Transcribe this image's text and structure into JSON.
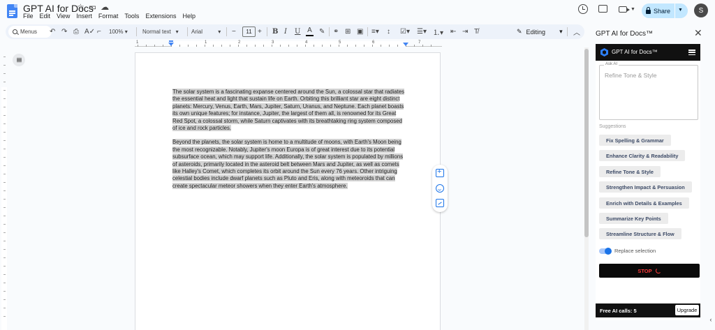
{
  "app": {
    "doc_title": "GPT AI for Docs",
    "menu": [
      "File",
      "Edit",
      "View",
      "Insert",
      "Format",
      "Tools",
      "Extensions",
      "Help"
    ],
    "share_label": "Share",
    "avatar_initial": "S"
  },
  "toolbar": {
    "menus_label": "Menus",
    "zoom": "100%",
    "style": "Normal text",
    "font": "Arial",
    "font_size": "11",
    "mode": "Editing"
  },
  "ruler": {
    "numbers": [
      "1",
      "1",
      "2",
      "3",
      "4",
      "5",
      "6",
      "7"
    ]
  },
  "document": {
    "paragraphs": [
      "The solar system is a fascinating expanse centered around the Sun, a colossal star that radiates the essential heat and light that sustain life on Earth. Orbiting this brilliant star are eight distinct planets: Mercury, Venus, Earth, Mars, Jupiter, Saturn, Uranus, and Neptune. Each planet boasts its own unique features; for instance, Jupiter, the largest of them all, is renowned for its Great Red Spot, a colossal storm, while Saturn captivates with its breathtaking ring system composed of ice and rock particles.",
      "Beyond the planets, the solar system is home to a multitude of moons, with Earth's Moon being the most recognizable. Notably, Jupiter's moon Europa is of great interest due to its potential subsurface ocean, which may support life. Additionally, the solar system is populated by millions of asteroids, primarily located in the asteroid belt between Mars and Jupiter, as well as comets like Halley's Comet, which completes its orbit around the Sun every 76 years. Other intriguing celestial bodies include dwarf planets such as Pluto and Eris, along with meteoroids that can create spectacular meteor showers when they enter Earth's atmosphere."
    ]
  },
  "side_panel": {
    "title": "GPT AI for Docs™",
    "addon_name": "GPT AI for Docs™",
    "ask_label": "Ask AI",
    "ask_placeholder": "Refine Tone & Style",
    "suggestions_label": "Suggestions",
    "suggestions": [
      "Fix Spelling & Grammar",
      "Enhance Clarity & Readability",
      "Refine Tone & Style",
      "Strengthen Impact & Persuasion",
      "Enrich with Details & Examples",
      "Summarize Key Points",
      "Streamline Structure & Flow"
    ],
    "replace_label": "Replace selection",
    "stop_label": "STOP",
    "free_calls": "Free AI calls: 5",
    "upgrade_label": "Upgrade"
  },
  "colors": {
    "accent": "#1a73e8",
    "share_bg": "#c2e7ff",
    "stop_text": "#ff3b3b",
    "selection": "#d3d3d3"
  }
}
